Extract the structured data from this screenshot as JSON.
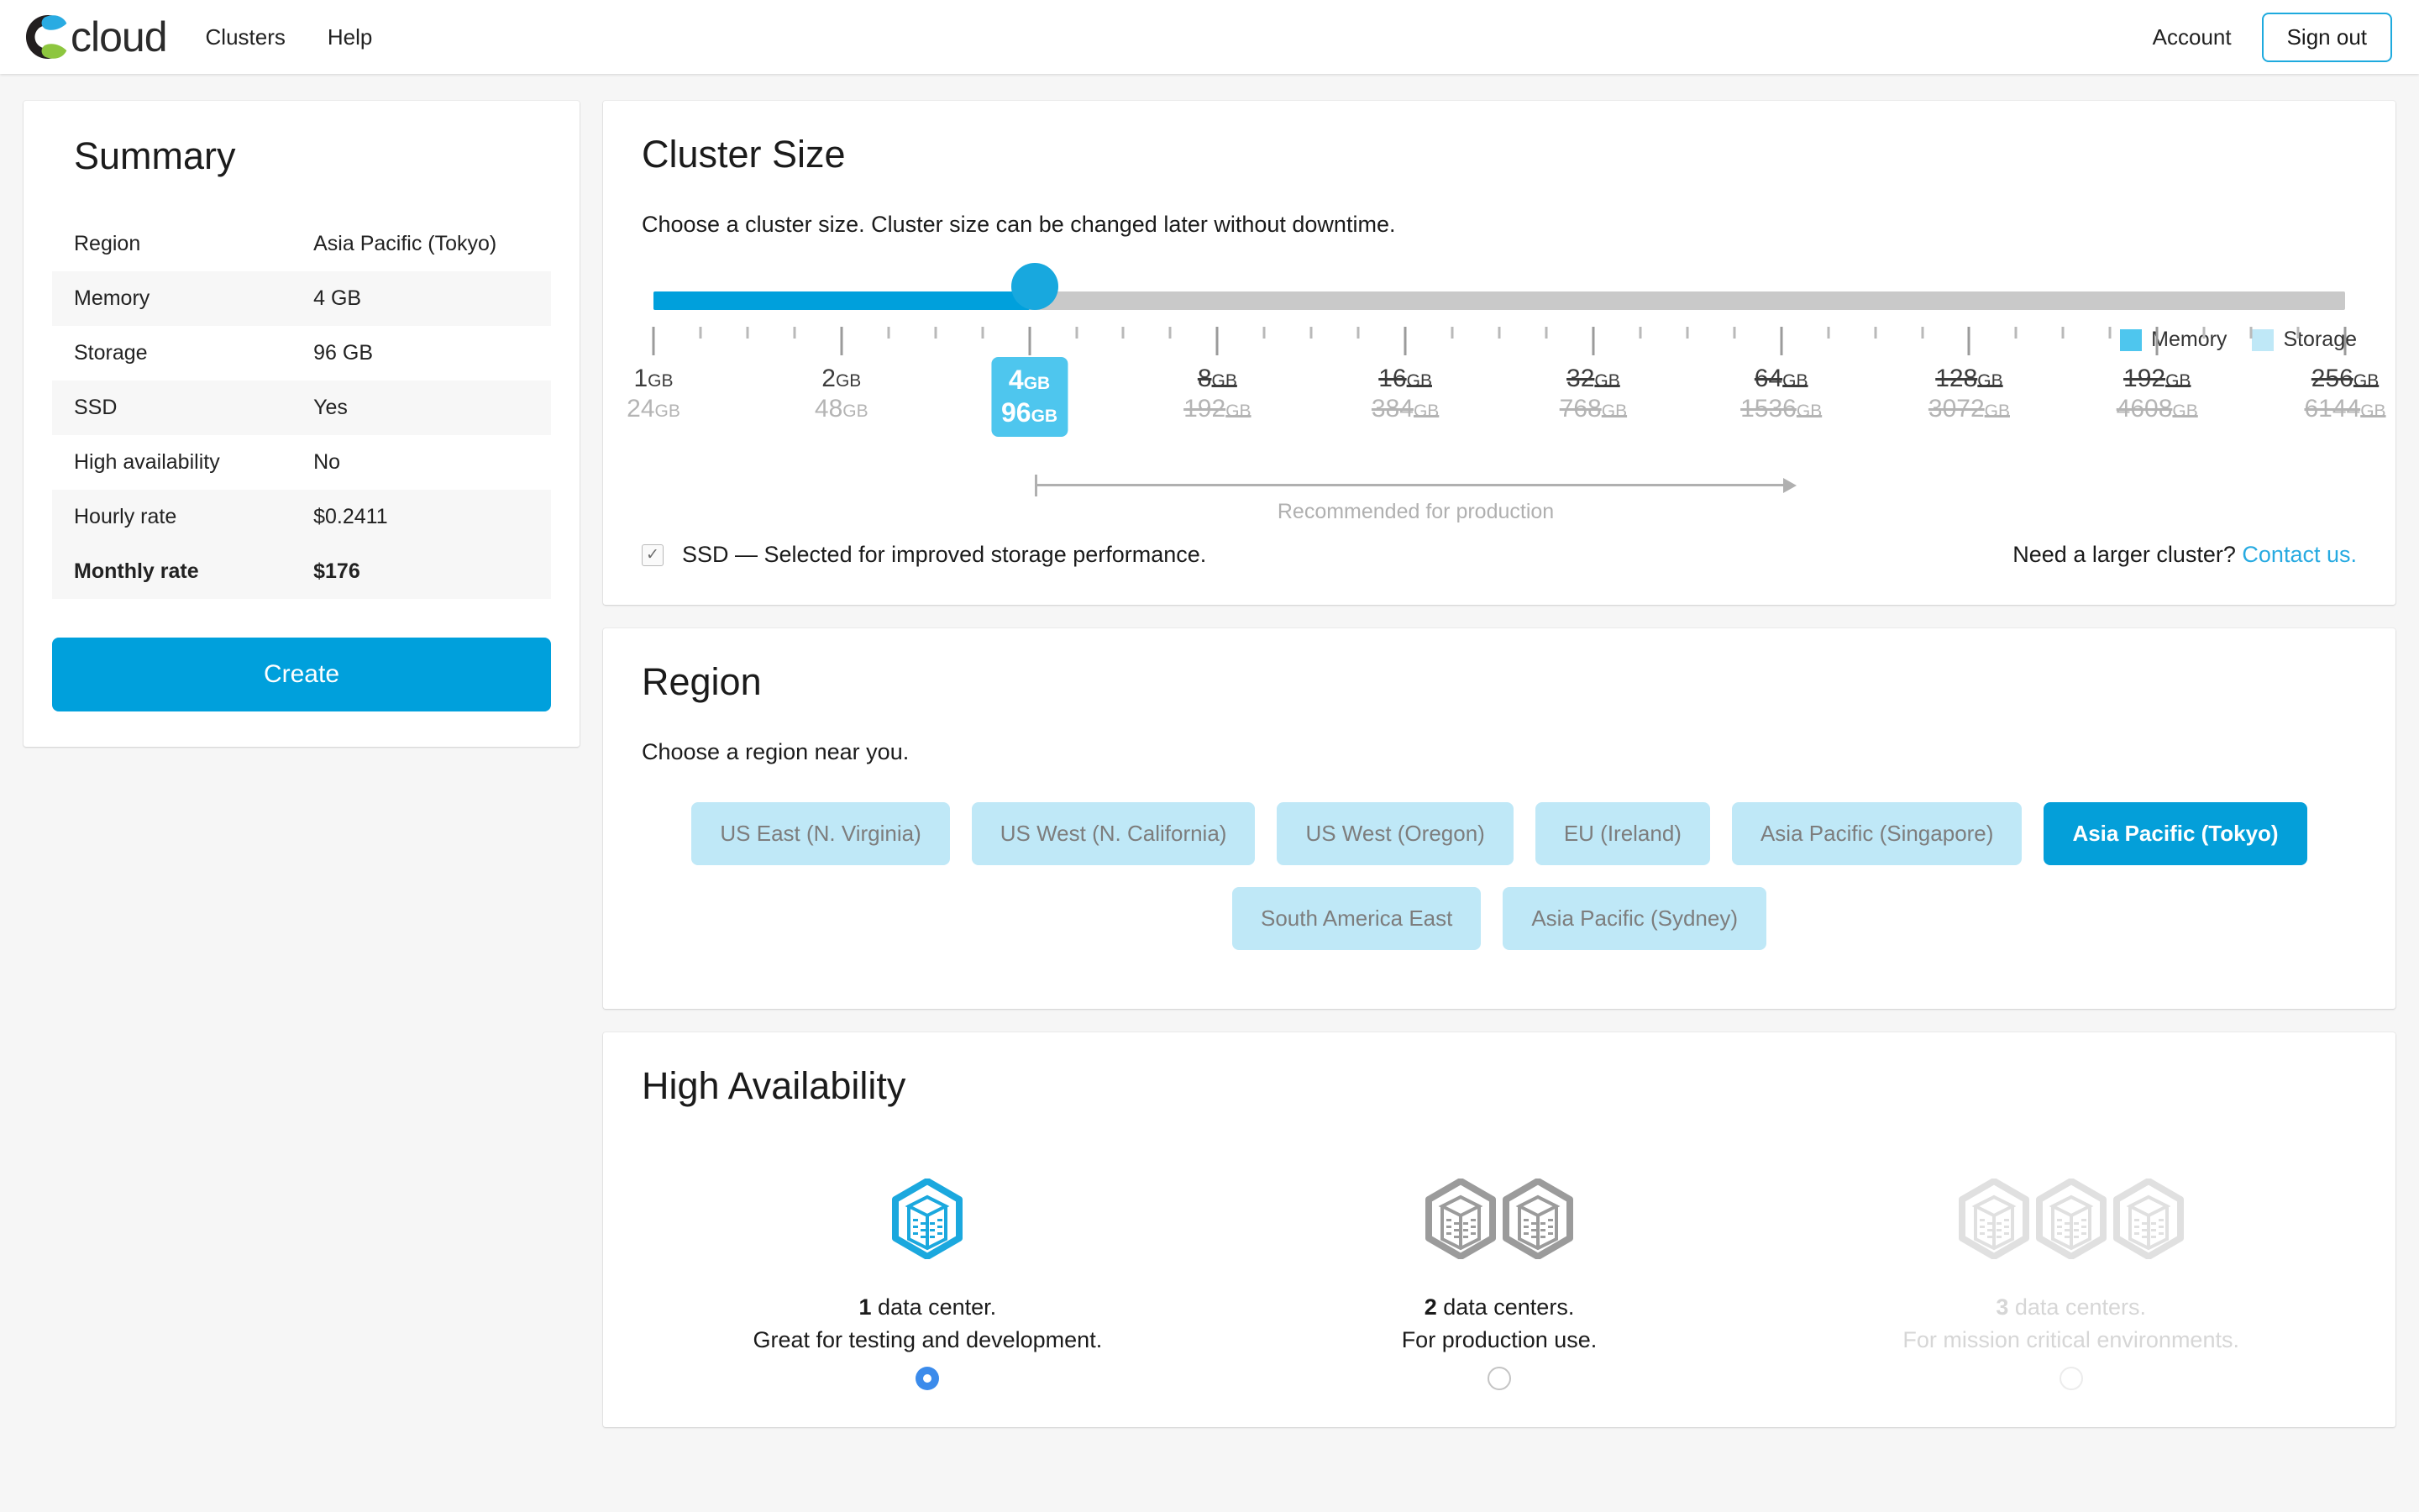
{
  "nav": {
    "brand": "cloud",
    "links": [
      {
        "label": "Clusters",
        "name": "nav-link-clusters"
      },
      {
        "label": "Help",
        "name": "nav-link-help"
      }
    ],
    "account": "Account",
    "signout": "Sign out"
  },
  "summary": {
    "title": "Summary",
    "rows": [
      {
        "label": "Region",
        "value": "Asia Pacific (Tokyo)"
      },
      {
        "label": "Memory",
        "value": "4 GB"
      },
      {
        "label": "Storage",
        "value": "96 GB"
      },
      {
        "label": "SSD",
        "value": "Yes"
      },
      {
        "label": "High availability",
        "value": "No"
      },
      {
        "label": "Hourly rate",
        "value": "$0.2411"
      },
      {
        "label": "Monthly rate",
        "value": "$176"
      }
    ],
    "create_label": "Create"
  },
  "cluster_size": {
    "title": "Cluster Size",
    "description": "Choose a cluster size. Cluster size can be changed later without downtime.",
    "legend": [
      {
        "label": "Memory",
        "color": "#4ec6ee"
      },
      {
        "label": "Storage",
        "color": "#bfe8f7"
      }
    ],
    "slider": {
      "selected_index": 2,
      "fill_color": "#00a0dc",
      "track_color": "#c9c9c9",
      "unit": "GB",
      "stops": [
        {
          "memory": "1",
          "storage": "24",
          "available": true
        },
        {
          "memory": "2",
          "storage": "48",
          "available": true
        },
        {
          "memory": "4",
          "storage": "96",
          "available": true
        },
        {
          "memory": "8",
          "storage": "192",
          "available": false
        },
        {
          "memory": "16",
          "storage": "384",
          "available": false
        },
        {
          "memory": "32",
          "storage": "768",
          "available": false
        },
        {
          "memory": "64",
          "storage": "1536",
          "available": false
        },
        {
          "memory": "128",
          "storage": "3072",
          "available": false
        },
        {
          "memory": "192",
          "storage": "4608",
          "available": false
        },
        {
          "memory": "256",
          "storage": "6144",
          "available": false
        }
      ]
    },
    "recommended_label": "Recommended for production",
    "ssd": {
      "checked": true,
      "check_glyph": "✓",
      "label": "SSD — Selected for improved storage performance."
    },
    "larger_prefix": "Need a larger cluster? ",
    "larger_link": "Contact us."
  },
  "region": {
    "title": "Region",
    "description": "Choose a region near you.",
    "row1": [
      {
        "label": "US East (N. Virginia)",
        "selected": false
      },
      {
        "label": "US West (N. California)",
        "selected": false
      },
      {
        "label": "US West (Oregon)",
        "selected": false
      },
      {
        "label": "EU (Ireland)",
        "selected": false
      },
      {
        "label": "Asia Pacific (Singapore)",
        "selected": false
      },
      {
        "label": "Asia Pacific (Tokyo)",
        "selected": true
      }
    ],
    "row2": [
      {
        "label": "South America East",
        "selected": false
      },
      {
        "label": "Asia Pacific (Sydney)",
        "selected": false
      }
    ]
  },
  "high_availability": {
    "title": "High Availability",
    "options": [
      {
        "count": "1",
        "line1_rest": " data center.",
        "line2": "Great for testing and development.",
        "icons": 1,
        "icon_color": "#1ba8de",
        "selected": true,
        "disabled": false
      },
      {
        "count": "2",
        "line1_rest": " data centers.",
        "line2": "For production use.",
        "icons": 2,
        "icon_color": "#9b9b9b",
        "selected": false,
        "disabled": false
      },
      {
        "count": "3",
        "line1_rest": " data centers.",
        "line2": "For mission critical environments.",
        "icons": 3,
        "icon_color": "#e0e0e0",
        "selected": false,
        "disabled": true
      }
    ]
  }
}
